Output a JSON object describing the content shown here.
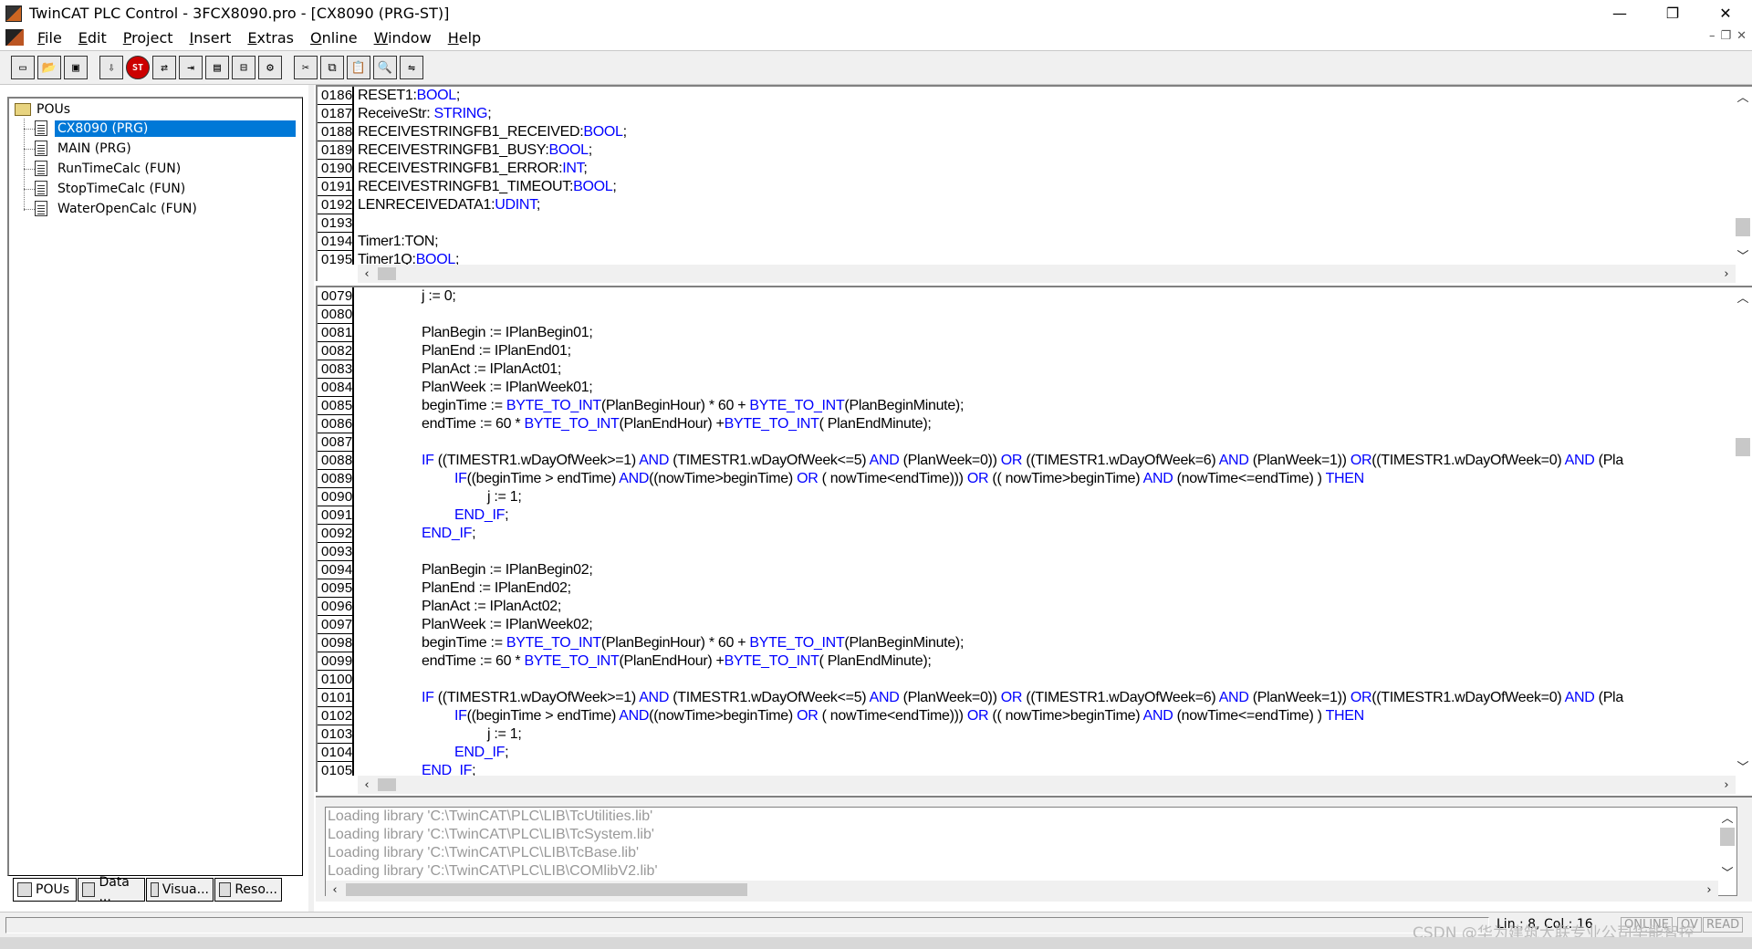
{
  "window": {
    "title": "TwinCAT PLC Control - 3FCX8090.pro - [CX8090 (PRG-ST)]",
    "minimize": "—",
    "restore": "❐",
    "close": "✕"
  },
  "menu": {
    "items": [
      {
        "u": "F",
        "rest": "ile"
      },
      {
        "u": "E",
        "rest": "dit"
      },
      {
        "u": "P",
        "rest": "roject"
      },
      {
        "u": "I",
        "rest": "nsert"
      },
      {
        "u": "E",
        "rest": "xtras"
      },
      {
        "u": "O",
        "rest": "nline"
      },
      {
        "u": "W",
        "rest": "indow"
      },
      {
        "u": "H",
        "rest": "elp"
      }
    ],
    "mdi_min": "–",
    "mdi_restore": "❐",
    "mdi_close": "✕"
  },
  "toolbar": {
    "buttons": [
      "new",
      "open",
      "save",
      "import",
      "stop",
      "login",
      "logout",
      "run",
      "step",
      "reset",
      "cut",
      "copy",
      "paste",
      "find"
    ]
  },
  "tree": {
    "root": "POUs",
    "items": [
      {
        "label": "CX8090 (PRG)",
        "selected": true
      },
      {
        "label": "MAIN (PRG)",
        "selected": false
      },
      {
        "label": "RunTimeCalc (FUN)",
        "selected": false
      },
      {
        "label": "StopTimeCalc (FUN)",
        "selected": false
      },
      {
        "label": "WaterOpenCalc (FUN)",
        "selected": false
      }
    ]
  },
  "bottom_tabs": [
    "POUs",
    "Data ...",
    "Visua...",
    "Reso..."
  ],
  "declarations": {
    "lines": [
      {
        "n": "0186",
        "t": [
          [
            "RESET1:",
            ""
          ],
          [
            "BOOL",
            "kw"
          ],
          [
            ";",
            ""
          ]
        ]
      },
      {
        "n": "0187",
        "t": [
          [
            "ReceiveStr: ",
            ""
          ],
          [
            "STRING",
            "kw"
          ],
          [
            ";",
            ""
          ]
        ]
      },
      {
        "n": "0188",
        "t": [
          [
            "RECEIVESTRINGFB1_RECEIVED:",
            ""
          ],
          [
            "BOOL",
            "kw"
          ],
          [
            ";",
            ""
          ]
        ]
      },
      {
        "n": "0189",
        "t": [
          [
            "RECEIVESTRINGFB1_BUSY:",
            ""
          ],
          [
            "BOOL",
            "kw"
          ],
          [
            ";",
            ""
          ]
        ]
      },
      {
        "n": "0190",
        "t": [
          [
            "RECEIVESTRINGFB1_ERROR:",
            ""
          ],
          [
            "INT",
            "kw"
          ],
          [
            ";",
            ""
          ]
        ]
      },
      {
        "n": "0191",
        "t": [
          [
            "RECEIVESTRINGFB1_TIMEOUT:",
            ""
          ],
          [
            "BOOL",
            "kw"
          ],
          [
            ";",
            ""
          ]
        ]
      },
      {
        "n": "0192",
        "t": [
          [
            "LENRECEIVEDATA1:",
            ""
          ],
          [
            "UDINT",
            "kw"
          ],
          [
            ";",
            ""
          ]
        ]
      },
      {
        "n": "0193",
        "t": []
      },
      {
        "n": "0194",
        "t": [
          [
            "Timer1:TON;",
            ""
          ]
        ]
      },
      {
        "n": "0195",
        "t": [
          [
            "Timer1Q:",
            ""
          ],
          [
            "BOOL",
            "kw"
          ],
          [
            ";",
            ""
          ]
        ]
      }
    ]
  },
  "code": {
    "lines": [
      {
        "n": "0079",
        "i": 2,
        "t": [
          [
            "j := 0;",
            ""
          ]
        ]
      },
      {
        "n": "0080",
        "i": 0,
        "t": []
      },
      {
        "n": "0081",
        "i": 2,
        "t": [
          [
            "PlanBegin := IPlanBegin01;",
            ""
          ]
        ]
      },
      {
        "n": "0082",
        "i": 2,
        "t": [
          [
            "PlanEnd := IPlanEnd01;",
            ""
          ]
        ]
      },
      {
        "n": "0083",
        "i": 2,
        "t": [
          [
            "PlanAct := IPlanAct01;",
            ""
          ]
        ]
      },
      {
        "n": "0084",
        "i": 2,
        "t": [
          [
            "PlanWeek := IPlanWeek01;",
            ""
          ]
        ]
      },
      {
        "n": "0085",
        "i": 2,
        "t": [
          [
            "beginTime := ",
            ""
          ],
          [
            "BYTE_TO_INT",
            "kw"
          ],
          [
            "(PlanBeginHour) * 60 + ",
            ""
          ],
          [
            "BYTE_TO_INT",
            "kw"
          ],
          [
            "(PlanBeginMinute);",
            ""
          ]
        ]
      },
      {
        "n": "0086",
        "i": 2,
        "t": [
          [
            "endTime := 60 * ",
            ""
          ],
          [
            "BYTE_TO_INT",
            "kw"
          ],
          [
            "(PlanEndHour) +",
            ""
          ],
          [
            "BYTE_TO_INT",
            "kw"
          ],
          [
            "( PlanEndMinute);",
            ""
          ]
        ]
      },
      {
        "n": "0087",
        "i": 0,
        "t": []
      },
      {
        "n": "0088",
        "i": 2,
        "t": [
          [
            "IF",
            "kw"
          ],
          [
            " ((TIMESTR1.wDayOfWeek>=1) ",
            ""
          ],
          [
            "AND",
            "kw"
          ],
          [
            " (TIMESTR1.wDayOfWeek<=5) ",
            ""
          ],
          [
            "AND",
            "kw"
          ],
          [
            " (PlanWeek=0)) ",
            ""
          ],
          [
            "OR",
            "kw"
          ],
          [
            " ((TIMESTR1.wDayOfWeek=6) ",
            ""
          ],
          [
            "AND",
            "kw"
          ],
          [
            " (PlanWeek=1)) ",
            ""
          ],
          [
            "OR",
            "kw"
          ],
          [
            "((TIMESTR1.wDayOfWeek=0) ",
            ""
          ],
          [
            "AND",
            "kw"
          ],
          [
            " (Pla",
            ""
          ]
        ]
      },
      {
        "n": "0089",
        "i": 3,
        "t": [
          [
            "IF",
            "kw"
          ],
          [
            "((beginTime > endTime) ",
            ""
          ],
          [
            "AND",
            "kw"
          ],
          [
            "((nowTime>beginTime) ",
            ""
          ],
          [
            "OR",
            "kw"
          ],
          [
            " ( nowTime<endTime))) ",
            ""
          ],
          [
            "OR",
            "kw"
          ],
          [
            " (( nowTime>beginTime) ",
            ""
          ],
          [
            "AND",
            "kw"
          ],
          [
            " (nowTime<=endTime) ) ",
            ""
          ],
          [
            "THEN",
            "kw"
          ]
        ]
      },
      {
        "n": "0090",
        "i": 4,
        "t": [
          [
            "j := 1;",
            ""
          ]
        ]
      },
      {
        "n": "0091",
        "i": 3,
        "t": [
          [
            "END_IF",
            "kw"
          ],
          [
            ";",
            ""
          ]
        ]
      },
      {
        "n": "0092",
        "i": 2,
        "t": [
          [
            "END_IF",
            "kw"
          ],
          [
            ";",
            ""
          ]
        ]
      },
      {
        "n": "0093",
        "i": 0,
        "t": []
      },
      {
        "n": "0094",
        "i": 2,
        "t": [
          [
            "PlanBegin := IPlanBegin02;",
            ""
          ]
        ]
      },
      {
        "n": "0095",
        "i": 2,
        "t": [
          [
            "PlanEnd := IPlanEnd02;",
            ""
          ]
        ]
      },
      {
        "n": "0096",
        "i": 2,
        "t": [
          [
            "PlanAct := IPlanAct02;",
            ""
          ]
        ]
      },
      {
        "n": "0097",
        "i": 2,
        "t": [
          [
            "PlanWeek := IPlanWeek02;",
            ""
          ]
        ]
      },
      {
        "n": "0098",
        "i": 2,
        "t": [
          [
            "beginTime := ",
            ""
          ],
          [
            "BYTE_TO_INT",
            "kw"
          ],
          [
            "(PlanBeginHour) * 60 + ",
            ""
          ],
          [
            "BYTE_TO_INT",
            "kw"
          ],
          [
            "(PlanBeginMinute);",
            ""
          ]
        ]
      },
      {
        "n": "0099",
        "i": 2,
        "t": [
          [
            "endTime := 60 * ",
            ""
          ],
          [
            "BYTE_TO_INT",
            "kw"
          ],
          [
            "(PlanEndHour) +",
            ""
          ],
          [
            "BYTE_TO_INT",
            "kw"
          ],
          [
            "( PlanEndMinute);",
            ""
          ]
        ]
      },
      {
        "n": "0100",
        "i": 0,
        "t": []
      },
      {
        "n": "0101",
        "i": 2,
        "t": [
          [
            "IF",
            "kw"
          ],
          [
            " ((TIMESTR1.wDayOfWeek>=1) ",
            ""
          ],
          [
            "AND",
            "kw"
          ],
          [
            " (TIMESTR1.wDayOfWeek<=5) ",
            ""
          ],
          [
            "AND",
            "kw"
          ],
          [
            " (PlanWeek=0)) ",
            ""
          ],
          [
            "OR",
            "kw"
          ],
          [
            " ((TIMESTR1.wDayOfWeek=6) ",
            ""
          ],
          [
            "AND",
            "kw"
          ],
          [
            " (PlanWeek=1)) ",
            ""
          ],
          [
            "OR",
            "kw"
          ],
          [
            "((TIMESTR1.wDayOfWeek=0) ",
            ""
          ],
          [
            "AND",
            "kw"
          ],
          [
            " (Pla",
            ""
          ]
        ]
      },
      {
        "n": "0102",
        "i": 3,
        "t": [
          [
            "IF",
            "kw"
          ],
          [
            "((beginTime > endTime) ",
            ""
          ],
          [
            "AND",
            "kw"
          ],
          [
            "((nowTime>beginTime) ",
            ""
          ],
          [
            "OR",
            "kw"
          ],
          [
            " ( nowTime<endTime))) ",
            ""
          ],
          [
            "OR",
            "kw"
          ],
          [
            " (( nowTime>beginTime) ",
            ""
          ],
          [
            "AND",
            "kw"
          ],
          [
            " (nowTime<=endTime) ) ",
            ""
          ],
          [
            "THEN",
            "kw"
          ]
        ]
      },
      {
        "n": "0103",
        "i": 4,
        "t": [
          [
            "j := 1;",
            ""
          ]
        ]
      },
      {
        "n": "0104",
        "i": 3,
        "t": [
          [
            "END_IF",
            "kw"
          ],
          [
            ";",
            ""
          ]
        ]
      },
      {
        "n": "0105",
        "i": 2,
        "t": [
          [
            "END_IF",
            "kw"
          ],
          [
            ";",
            ""
          ]
        ]
      }
    ]
  },
  "messages": [
    "Loading library 'C:\\TwinCAT\\PLC\\LIB\\TcUtilities.lib'",
    "Loading library 'C:\\TwinCAT\\PLC\\LIB\\TcSystem.lib'",
    "Loading library 'C:\\TwinCAT\\PLC\\LIB\\TcBase.lib'",
    "Loading library 'C:\\TwinCAT\\PLC\\LIB\\COMlibV2.lib'"
  ],
  "status": {
    "position": "Lin.: 8, Col.: 16",
    "online": "ONLINE",
    "ov": "OV",
    "read": "READ"
  },
  "watermark": "CSDN @华为建筑大联专业公司华能智控",
  "colors": {
    "keyword": "#0000ff",
    "selection": "#0078d7"
  }
}
